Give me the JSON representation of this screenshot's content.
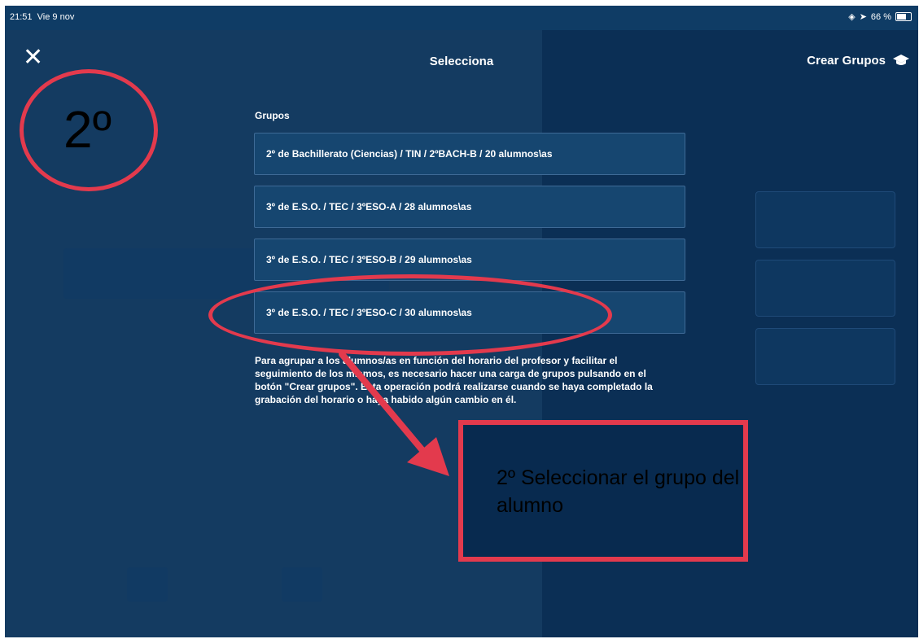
{
  "status_bar": {
    "time": "21:51",
    "date": "Vie 9 nov",
    "battery": "66 %"
  },
  "header": {
    "title": "Selecciona",
    "action_label": "Crear Grupos"
  },
  "groups": {
    "label": "Grupos",
    "items": [
      "2º de Bachillerato (Ciencias) / TIN / 2ºBACH-B / 20 alumnos\\as",
      "3º de E.S.O. / TEC / 3ºESO-A / 28 alumnos\\as",
      "3º de E.S.O. / TEC / 3ºESO-B / 29 alumnos\\as",
      "3º de E.S.O. / TEC / 3ºESO-C / 30 alumnos\\as"
    ]
  },
  "info_text": "Para agrupar a los alumnos/as en función del horario del profesor y facilitar el seguimiento de los mismos, es necesario hacer una carga de grupos pulsando en el botón \"Crear grupos\". Esta operación podrá realizarse cuando se haya completado la grabación del horario o haya habido algún cambio en él.",
  "annotations": {
    "step_number": "2º",
    "step_text": "2º Seleccionar  el grupo del alumno",
    "color": "#e33a4d"
  },
  "colors": {
    "background": "#0f3c65",
    "row_fill": "#164670",
    "row_border": "#3e6a96"
  }
}
